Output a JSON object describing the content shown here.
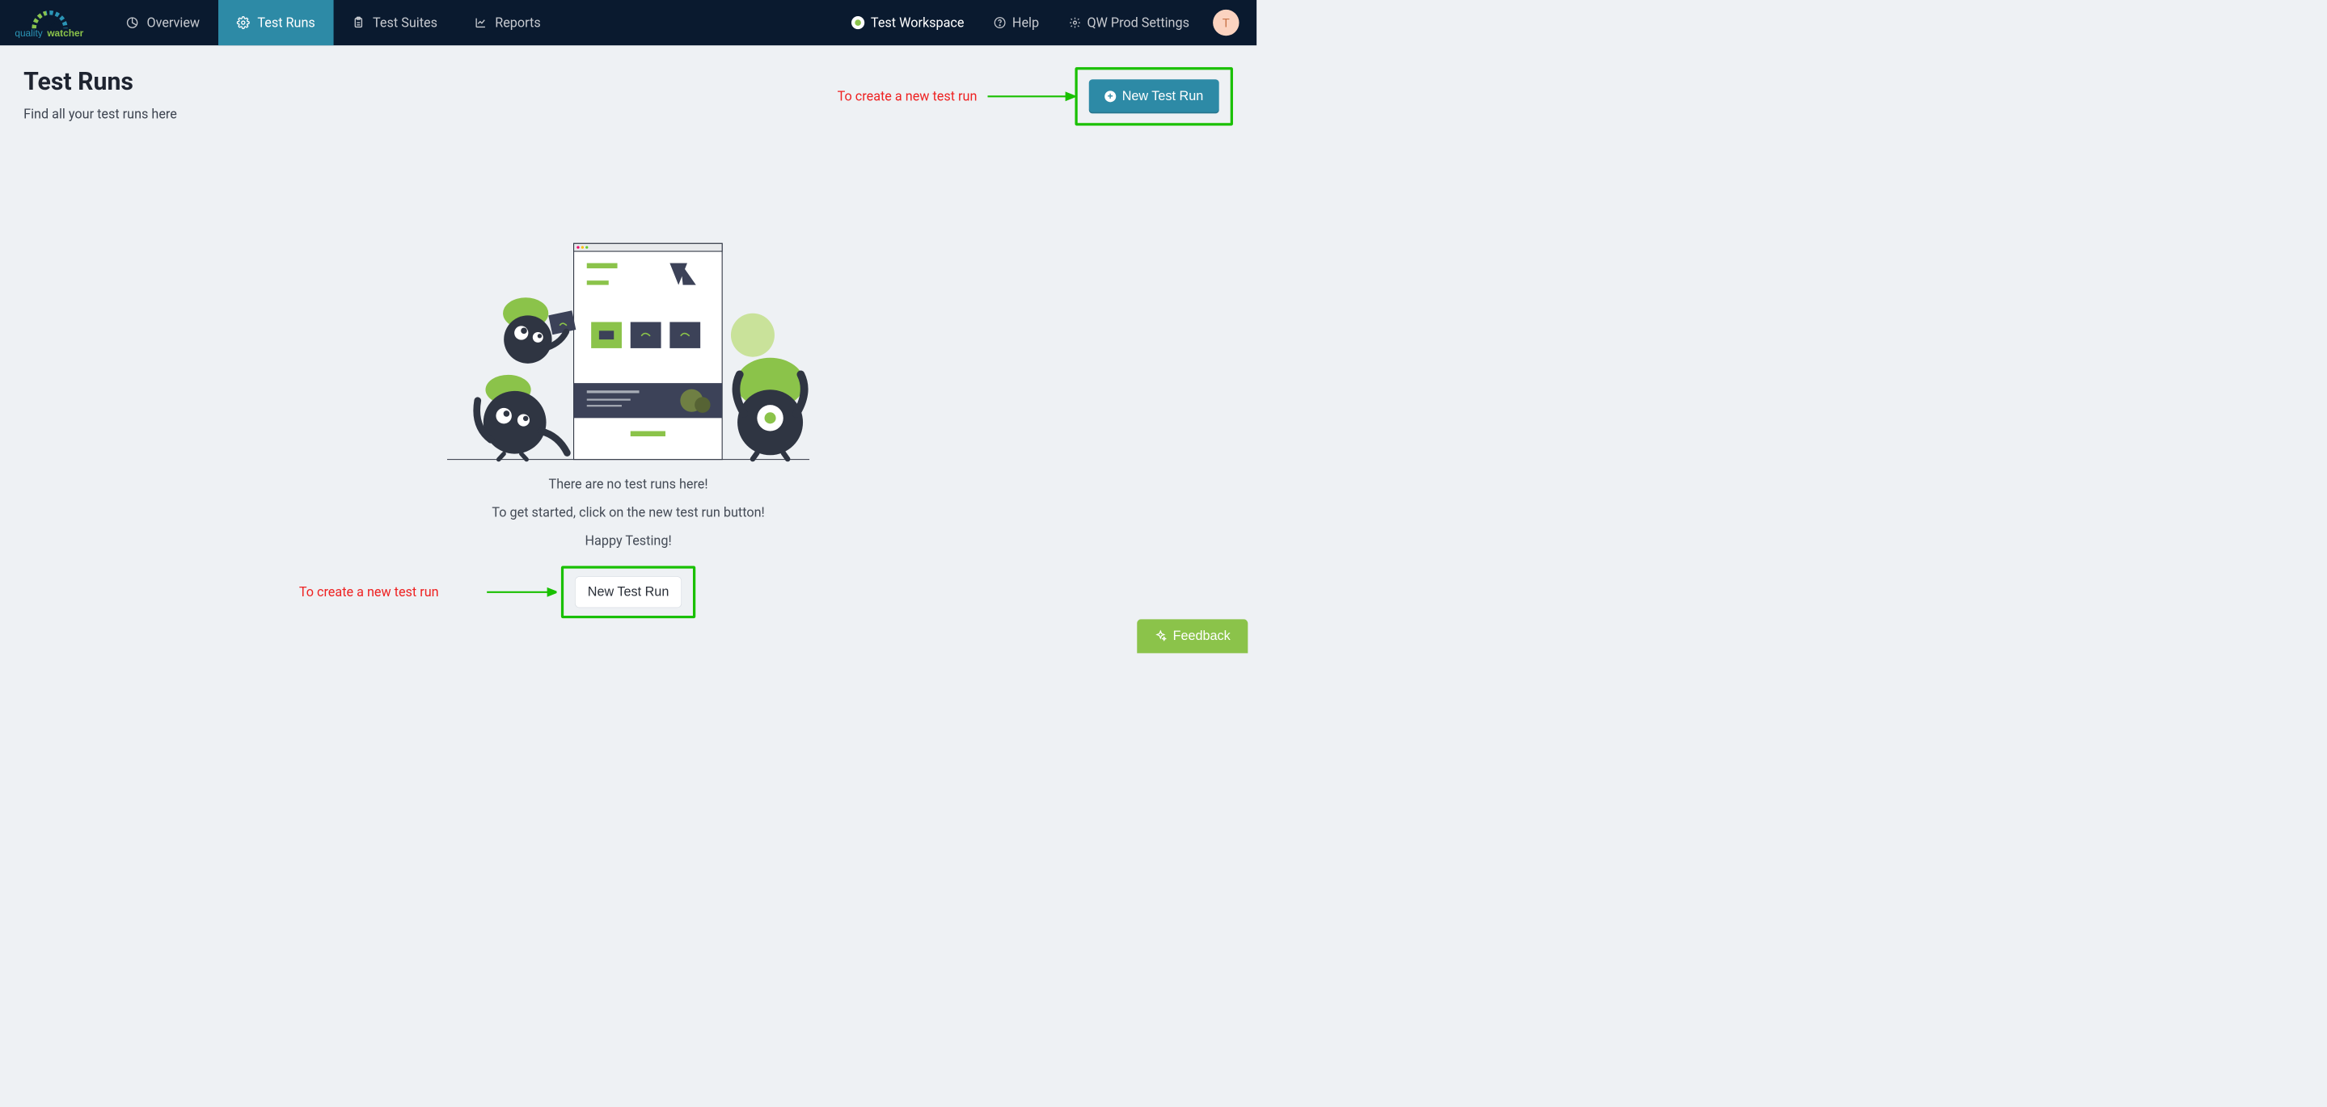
{
  "brand": {
    "name1": "quality",
    "name2": "watcher"
  },
  "nav": {
    "overview": "Overview",
    "test_runs": "Test Runs",
    "test_suites": "Test Suites",
    "reports": "Reports"
  },
  "right": {
    "workspace": "Test Workspace",
    "help": "Help",
    "settings": "QW Prod Settings",
    "avatar_initial": "T"
  },
  "page": {
    "title": "Test Runs",
    "subtitle": "Find all your test runs here",
    "new_button": "New Test Run"
  },
  "empty": {
    "line1": "There are no test runs here!",
    "line2": "To get started, click on the new test run button!",
    "line3": "Happy Testing!",
    "cta": "New Test Run"
  },
  "annotations": {
    "top": "To create a new test run",
    "mid": "To create a new test run"
  },
  "feedback": "Feedback"
}
